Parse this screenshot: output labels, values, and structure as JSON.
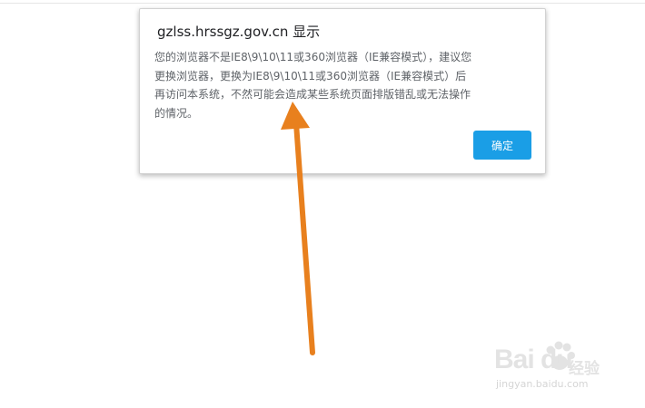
{
  "dialog": {
    "title": "gzlss.hrssgz.gov.cn 显示",
    "message": "您的浏览器不是IE8\\9\\10\\11或360浏览器（IE兼容模式），建议您更换浏览器，更换为IE8\\9\\10\\11或360浏览器（IE兼容模式）后再访问本系统，不然可能会造成某些系统页面排版错乱或无法操作的情况。",
    "ok_label": "确定"
  },
  "watermark": {
    "logo_text": "Bai du",
    "jingyan_text": "经验",
    "url_text": "jingyan.baidu.com"
  },
  "colors": {
    "ok_button": "#1a9ee6",
    "arrow": "#e8801e"
  }
}
